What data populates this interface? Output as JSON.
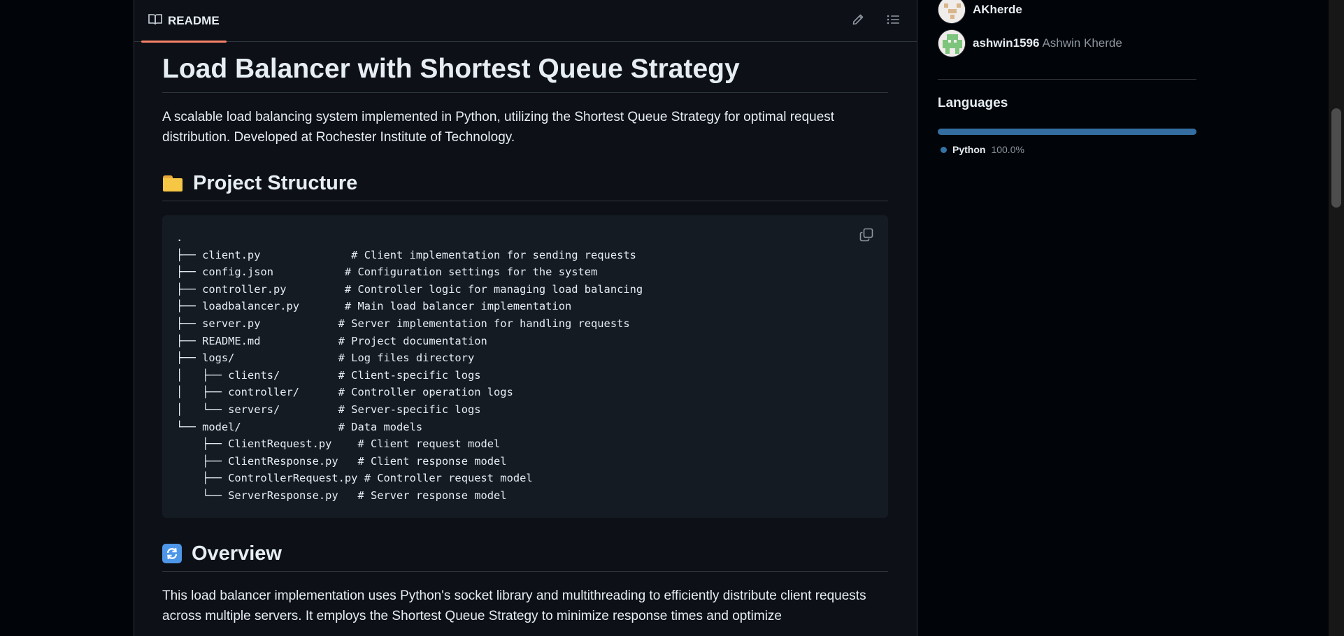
{
  "readme": {
    "tab_label": "README",
    "edit_label": "Edit file",
    "outline_label": "Outline"
  },
  "markdown": {
    "title": "Load Balancer with Shortest Queue Strategy",
    "intro": "A scalable load balancing system implemented in Python, utilizing the Shortest Queue Strategy for optimal request distribution. Developed at Rochester Institute of Technology.",
    "section1_heading": "Project Structure",
    "code": ".\n├── client.py              # Client implementation for sending requests\n├── config.json           # Configuration settings for the system\n├── controller.py         # Controller logic for managing load balancing\n├── loadbalancer.py       # Main load balancer implementation\n├── server.py            # Server implementation for handling requests\n├── README.md            # Project documentation\n├── logs/                # Log files directory\n│   ├── clients/         # Client-specific logs\n│   ├── controller/      # Controller operation logs\n│   └── servers/         # Server-specific logs\n└── model/               # Data models\n    ├── ClientRequest.py    # Client request model\n    ├── ClientResponse.py   # Client response model\n    ├── ControllerRequest.py # Controller request model\n    └── ServerResponse.py   # Server response model",
    "section2_heading": "Overview",
    "overview": "This load balancer implementation uses Python's socket library and multithreading to efficiently distribute client requests across multiple servers. It employs the Shortest Queue Strategy to minimize response times and optimize"
  },
  "sidebar": {
    "contributors": [
      {
        "login": "AKherde",
        "fullname": ""
      },
      {
        "login": "ashwin1596",
        "fullname": "Ashwin Kherde"
      }
    ],
    "languages_title": "Languages",
    "languages": [
      {
        "name": "Python",
        "percent": "100.0%",
        "fraction": 1.0,
        "color": "#3572a5"
      }
    ]
  },
  "colors": {
    "background": "#0d1117",
    "accent": "#f78166",
    "python": "#3572a5"
  }
}
